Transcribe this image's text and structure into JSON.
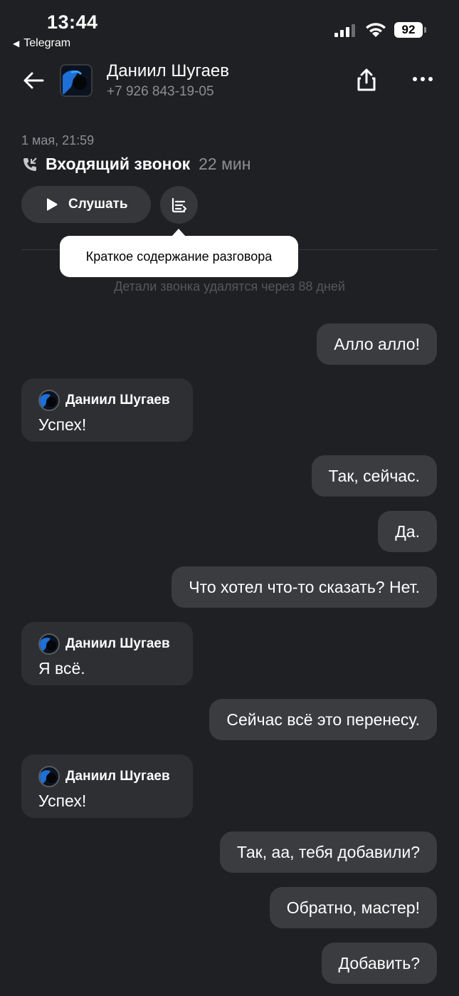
{
  "status_bar": {
    "time": "13:44",
    "back_app": "Telegram",
    "battery": "92"
  },
  "header": {
    "name": "Даниил Шугаев",
    "phone": "+7 926 843-19-05"
  },
  "call": {
    "date": "1 мая, 21:59",
    "title": "Входящий звонок",
    "duration": "22 мин",
    "listen_label": "Слушать",
    "tooltip": "Краткое содержание разговора",
    "details_note": "Детали звонка удалятся через 88 дней"
  },
  "messages": [
    {
      "side": "out",
      "text": "Алло алло!"
    },
    {
      "side": "in",
      "sender": "Даниил Шугаев",
      "text": "Успех!"
    },
    {
      "side": "out",
      "text": "Так, сейчас."
    },
    {
      "side": "out",
      "text": "Да."
    },
    {
      "side": "out",
      "text": "Что хотел что-то сказать? Нет."
    },
    {
      "side": "in",
      "sender": "Даниил Шугаев",
      "text": "Я всё."
    },
    {
      "side": "out",
      "text": "Сейчас всё это перенесу."
    },
    {
      "side": "in",
      "sender": "Даниил Шугаев",
      "text": "Успех!"
    },
    {
      "side": "out",
      "text": "Так, аа, тебя добавили?"
    },
    {
      "side": "out",
      "text": "Обратно, мастер!"
    },
    {
      "side": "out",
      "text": "Добавить?"
    }
  ],
  "icons": {
    "back": "arrow-left-icon",
    "share": "share-icon",
    "more": "more-icon",
    "phone": "incoming-call-icon",
    "play": "play-icon",
    "summary": "summary-icon"
  }
}
